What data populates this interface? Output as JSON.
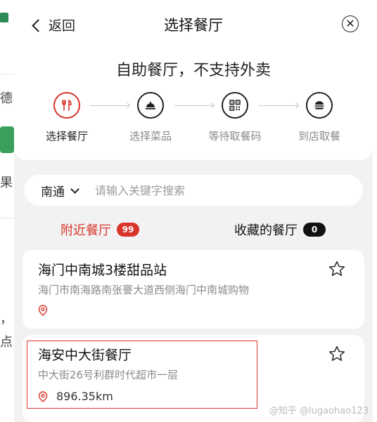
{
  "background": {
    "left_text_1": "德",
    "left_text_2": "果",
    "left_text_3": "，",
    "left_text_4": "点"
  },
  "header": {
    "back_label": "返回",
    "title": "选择餐厅",
    "close_icon": "close-circle-icon"
  },
  "subtitle": "自助餐厅，不支持外卖",
  "steps": [
    {
      "label": "选择餐厅",
      "icon": "fork-knife-icon",
      "active": true
    },
    {
      "label": "选择菜品",
      "icon": "cloche-icon",
      "active": false
    },
    {
      "label": "等待取餐码",
      "icon": "qr-code-icon",
      "active": false
    },
    {
      "label": "到店取餐",
      "icon": "burger-icon",
      "active": false
    }
  ],
  "search": {
    "city": "南通",
    "placeholder": "请输入关键字搜索"
  },
  "tabs": {
    "nearby_label": "附近餐厅",
    "nearby_count": "99",
    "favorites_label": "收藏的餐厅",
    "favorites_count": "0"
  },
  "restaurants": [
    {
      "name": "海门中南城3楼甜品站",
      "address": "海门市南海路南张謇大道西侧海门中南城购物",
      "distance": ""
    },
    {
      "name": "海安中大街餐厅",
      "address": "中大街26号利群时代超市一层",
      "distance": "896.35km"
    }
  ],
  "watermark": "@知乎 @lugaohao123",
  "colors": {
    "accent": "#d9342b",
    "background": "#f2f2f2",
    "card": "#ffffff",
    "muted_text": "#8a8a8a"
  }
}
